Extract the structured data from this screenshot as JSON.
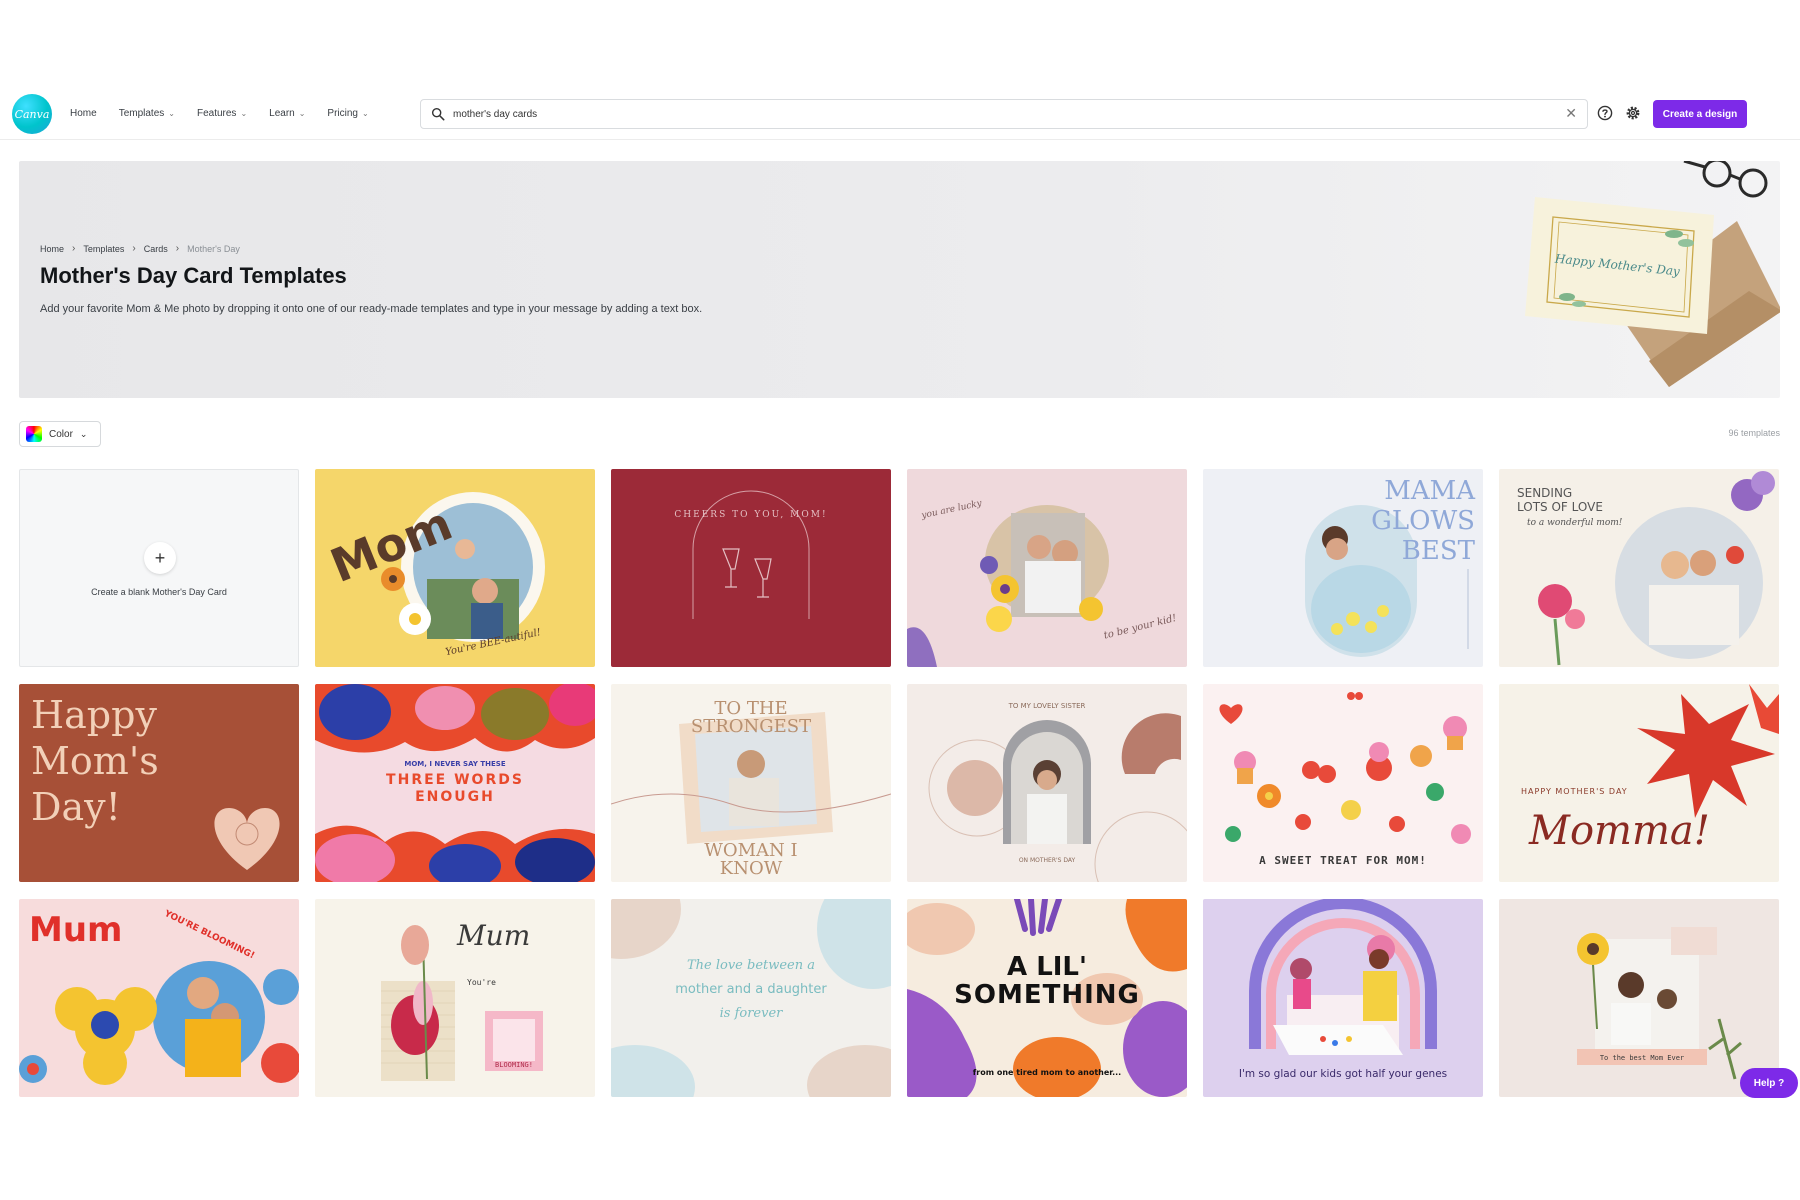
{
  "header": {
    "logo_text": "Canva",
    "nav": [
      "Home",
      "Templates",
      "Features",
      "Learn",
      "Pricing"
    ],
    "search_value": "mother's day cards",
    "create_label": "Create a design"
  },
  "hero": {
    "breadcrumbs": [
      "Home",
      "Templates",
      "Cards",
      "Mother's Day"
    ],
    "title": "Mother's Day Card Templates",
    "description": "Add your favorite Mom & Me photo by dropping it onto one of our ready-made templates and type in your message by adding a text box.",
    "card_text": "Happy Mother's Day"
  },
  "filters": {
    "color_label": "Color",
    "count": "96 templates"
  },
  "blank_card_label": "Create a blank Mother's Day Card",
  "cards": {
    "c1": [
      "Mom",
      "You're BEE-autiful!"
    ],
    "c2": [
      "CHEERS TO YOU, MOM!"
    ],
    "c3": [
      "you are lucky",
      "to be your kid!"
    ],
    "c4": [
      "MAMA",
      "GLOWS",
      "BEST"
    ],
    "c5": [
      "SENDING",
      "LOTS OF LOVE",
      "to a wonderful mom!"
    ],
    "c6": [
      "Happy",
      "Mom's",
      "Day!"
    ],
    "c7": [
      "MOM, I NEVER SAY THESE",
      "THREE WORDS",
      "ENOUGH"
    ],
    "c8": [
      "TO THE",
      "STRONGEST",
      "WOMAN I",
      "KNOW"
    ],
    "c9": [
      "TO MY LOVELY SISTER",
      "ON MOTHER'S DAY"
    ],
    "c10": [
      "A SWEET TREAT FOR MOM!"
    ],
    "c11": [
      "HAPPY MOTHER'S DAY",
      "Momma!"
    ],
    "c12": [
      "Mum",
      "YOU'RE BLOOMING!"
    ],
    "c13": [
      "Mum",
      "You're",
      "BLOOMING!"
    ],
    "c14": [
      "The love between a",
      "mother and a daughter",
      "is forever"
    ],
    "c15": [
      "A LIL'",
      "SOMETHING",
      "from one tired mom to another..."
    ],
    "c16": [
      "I'm so glad our kids got half your genes"
    ],
    "c17": [
      "To the best Mom Ever"
    ]
  },
  "help_label": "Help ?"
}
